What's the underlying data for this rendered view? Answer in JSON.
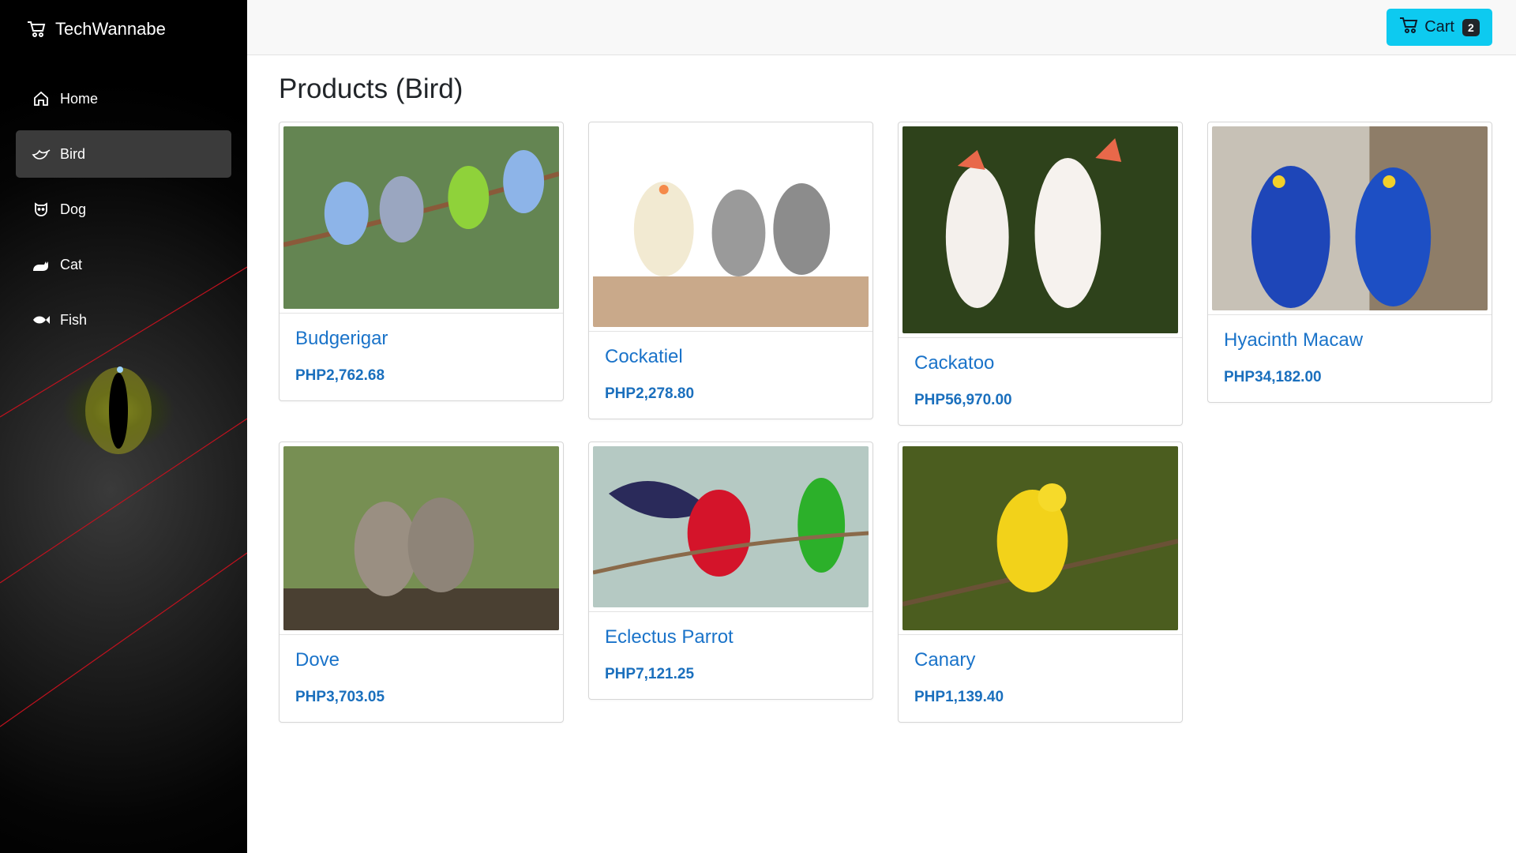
{
  "app": {
    "brand": "TechWannabe"
  },
  "sidebar": {
    "items": [
      {
        "label": "Home",
        "icon": "home-icon"
      },
      {
        "label": "Bird",
        "icon": "bird-icon",
        "active": true
      },
      {
        "label": "Dog",
        "icon": "dog-icon"
      },
      {
        "label": "Cat",
        "icon": "cat-icon"
      },
      {
        "label": "Fish",
        "icon": "fish-icon"
      }
    ]
  },
  "header": {
    "cart_label": "Cart",
    "cart_count": "2"
  },
  "main": {
    "title": "Products (Bird)",
    "products": [
      {
        "name": "Budgerigar",
        "price": "PHP2,762.68"
      },
      {
        "name": "Cockatiel",
        "price": "PHP2,278.80"
      },
      {
        "name": "Cackatoo",
        "price": "PHP56,970.00"
      },
      {
        "name": "Hyacinth Macaw",
        "price": "PHP34,182.00"
      },
      {
        "name": "Dove",
        "price": "PHP3,703.05"
      },
      {
        "name": "Eclectus Parrot",
        "price": "PHP7,121.25"
      },
      {
        "name": "Canary",
        "price": "PHP1,139.40"
      }
    ]
  },
  "colors": {
    "accent": "#0dcaf0",
    "link": "#1a73c9",
    "sidebar_active": "#3b3b3b"
  }
}
